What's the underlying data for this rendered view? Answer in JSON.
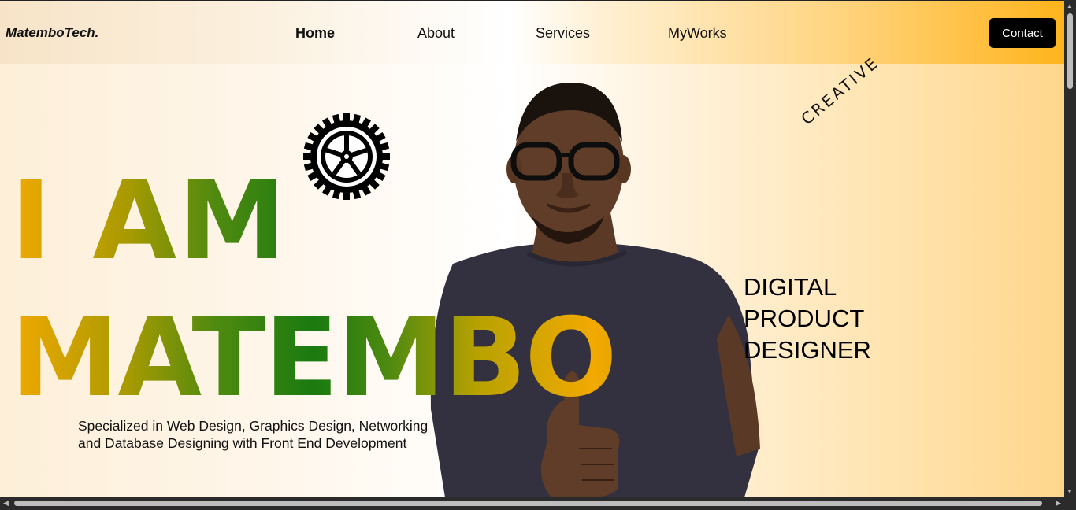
{
  "nav": {
    "logo": "MatemboTech.",
    "links": [
      {
        "label": "Home",
        "active": true
      },
      {
        "label": "About",
        "active": false
      },
      {
        "label": "Services",
        "active": false
      },
      {
        "label": "MyWorks",
        "active": false
      }
    ],
    "contact_label": "Contact"
  },
  "hero": {
    "line1": "I AM",
    "line2": "MATEMBO",
    "tagline_line1": "Specialized in Web Design, Graphics Design, Networking",
    "tagline_line2": "and Database Designing with Front End Development",
    "role": [
      "DIGITAL",
      "PRODUCT",
      "DESIGNER"
    ],
    "badge": "CREATIVE",
    "gradient_colors": [
      "#f2a900",
      "#1a7a10"
    ]
  },
  "icons": {
    "gear": "gear-icon",
    "person": "portrait-photo"
  }
}
